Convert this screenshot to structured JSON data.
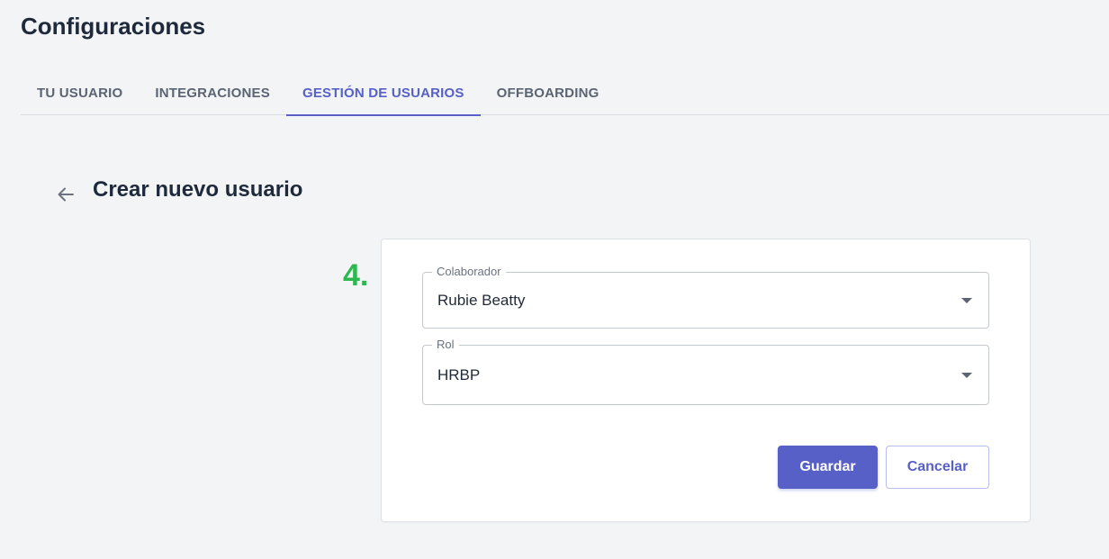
{
  "page": {
    "title": "Configuraciones"
  },
  "tabs": [
    {
      "label": "TU USUARIO",
      "active": false
    },
    {
      "label": "INTEGRACIONES",
      "active": false
    },
    {
      "label": "GESTIÓN DE USUARIOS",
      "active": true
    },
    {
      "label": "OFFBOARDING",
      "active": false
    }
  ],
  "section": {
    "title": "Crear nuevo usuario",
    "back_icon": "arrow-left-icon"
  },
  "step": {
    "number": "4."
  },
  "form": {
    "colaborador": {
      "label": "Colaborador",
      "value": "Rubie Beatty"
    },
    "rol": {
      "label": "Rol",
      "value": "HRBP"
    },
    "save_label": "Guardar",
    "cancel_label": "Cancelar"
  },
  "colors": {
    "accent": "#5660c7",
    "step": "#2db84d",
    "background": "#f3f4f6"
  }
}
